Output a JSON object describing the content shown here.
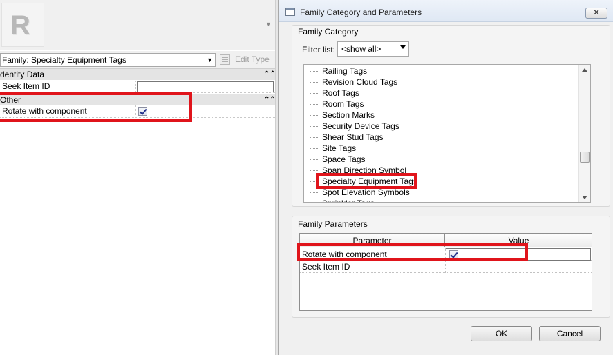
{
  "properties": {
    "logo_letter": "R",
    "type_selector": "Family: Specialty Equipment Tags",
    "edit_type_label": "Edit Type",
    "groups": [
      {
        "label": "dentity Data",
        "rows": [
          {
            "label": "Seek Item ID",
            "value": ""
          }
        ]
      },
      {
        "label": "Other",
        "rows": [
          {
            "label": "Rotate with component",
            "checked": true
          }
        ]
      }
    ],
    "collapse_glyph": "⌃⌃"
  },
  "dialog": {
    "title": "Family Category and Parameters",
    "close_label": "✕",
    "family_category": {
      "title": "Family Category",
      "filter_label": "Filter list:",
      "filter_value": "<show all>",
      "items": [
        "Railing Tags",
        "Revision Cloud Tags",
        "Roof Tags",
        "Room Tags",
        "Section Marks",
        "Security Device Tags",
        "Shear Stud Tags",
        "Site Tags",
        "Space Tags",
        "Span Direction Symbol",
        "Specialty Equipment Tags",
        "Spot Elevation Symbols",
        "Sprinkler Tags"
      ],
      "selected": "Specialty Equipment Tags"
    },
    "family_parameters": {
      "title": "Family Parameters",
      "columns": [
        "Parameter",
        "Value"
      ],
      "rows": [
        {
          "parameter": "Rotate with component",
          "checked": true
        },
        {
          "parameter": "Seek Item ID",
          "value": ""
        }
      ]
    },
    "buttons": {
      "ok": "OK",
      "cancel": "Cancel"
    }
  },
  "colors": {
    "highlight_box": "#e0141b",
    "dialog_bg": "#f0f0f0",
    "checkmark": "#21308b"
  }
}
